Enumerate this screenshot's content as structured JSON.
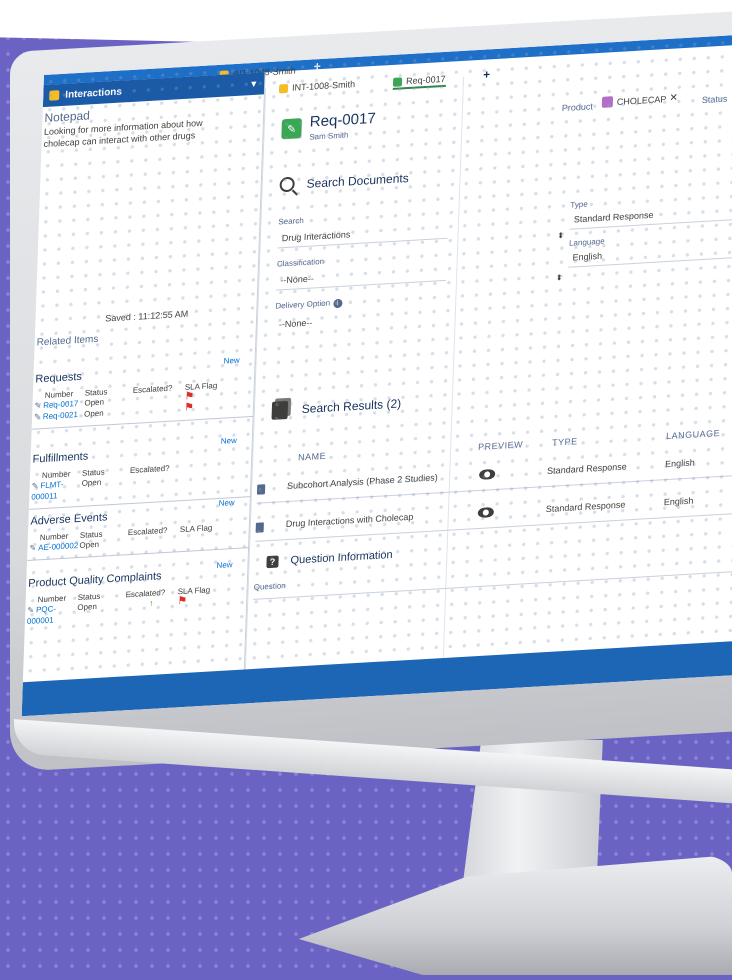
{
  "colors": {
    "backdrop": "#6a63c4",
    "header_blue": "#1a5aa6",
    "accent_green": "#3ba755",
    "link_blue": "#0070d2",
    "flag_red": "#e02b2b",
    "arrow_green": "#2e844a"
  },
  "utility_panel": {
    "title": "Interactions",
    "caret": "▼"
  },
  "tabs": {
    "workspace_tab": "INT-1008-Smith",
    "plus": "+",
    "sub_tab_1": "INT-1008-Smith",
    "sub_tab_2": "Req-0017",
    "sub_plus": "+"
  },
  "notepad": {
    "title": "Notepad",
    "text": "Looking for more information about how cholecap can interact with other drugs",
    "saved": "Saved : 11:12:55 AM"
  },
  "related": {
    "title": "Related Items",
    "requests": {
      "title": "Requests",
      "new_label": "New",
      "columns": [
        "Number",
        "Status",
        "Escalated?",
        "SLA Flag"
      ],
      "rows": [
        {
          "number": "Req-0017",
          "status": "Open",
          "escalated": "",
          "flag": "⚑"
        },
        {
          "number": "Req-0021",
          "status": "Open",
          "escalated": "",
          "flag": "⚑"
        }
      ]
    },
    "fulfillments": {
      "title": "Fulfillments",
      "new_label": "New",
      "columns": [
        "Number",
        "Status",
        "Escalated?"
      ],
      "rows": [
        {
          "number": "FLMT-000011",
          "status": "Open"
        }
      ]
    },
    "adverse_events": {
      "title": "Adverse Events",
      "new_label": "New",
      "columns": [
        "Number",
        "Status",
        "Escalated?",
        "SLA Flag"
      ],
      "rows": [
        {
          "number": "AE-000002",
          "status": "Open"
        }
      ]
    },
    "pqc": {
      "title": "Product Quality Complaints",
      "new_label": "New",
      "columns": [
        "Number",
        "Status",
        "Escalated?",
        "SLA Flag"
      ],
      "rows": [
        {
          "number": "PQC-000001",
          "status": "Open",
          "escalated": "↑",
          "flag": "⚑"
        }
      ]
    }
  },
  "record": {
    "title": "Req-0017",
    "subtitle": "Sam Smith",
    "product_label": "Product",
    "product_value": "CHOLECAP",
    "product_remove": "✕",
    "status_label": "Status"
  },
  "search": {
    "title": "Search Documents",
    "search_label": "Search",
    "search_value": "Drug Interactions",
    "classification_label": "Classification",
    "classification_value": "--None--",
    "delivery_label": "Delivery Option",
    "delivery_value": "--None--",
    "type_label": "Type",
    "type_value": "Standard Response",
    "language_label": "Language",
    "language_value": "English"
  },
  "results": {
    "title": "Search Results (2)",
    "columns": {
      "name": "NAME",
      "preview": "PREVIEW",
      "type": "TYPE",
      "language": "LANGUAGE"
    },
    "rows": [
      {
        "name": "Subcohort Analysis (Phase 2 Studies)",
        "type": "Standard Response",
        "language": "English"
      },
      {
        "name": "Drug Interactions with Cholecap",
        "type": "Standard Response",
        "language": "English"
      }
    ]
  },
  "question": {
    "title": "Question Information",
    "question_label": "Question"
  }
}
